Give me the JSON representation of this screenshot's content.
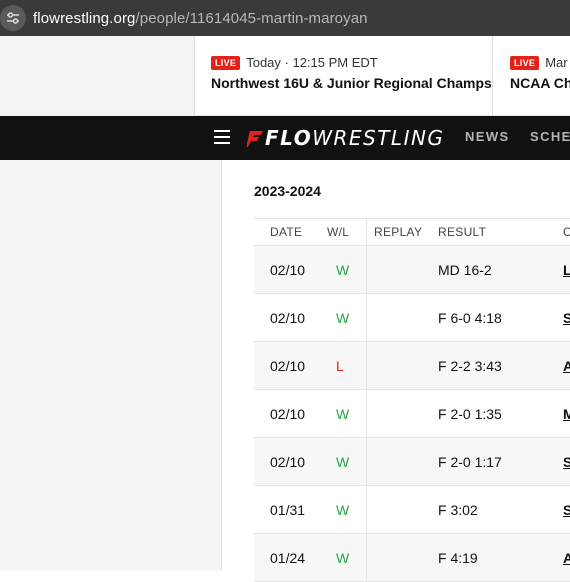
{
  "browser": {
    "url_host": "flowrestling.org",
    "url_path": "/people/11614045-martin-maroyan",
    "site_info_icon": "tune-icon"
  },
  "ticker": {
    "events": [
      {
        "badge": "LIVE",
        "when": "Today · 12:15 PM EDT",
        "title": "Northwest 16U & Junior Regional Champs"
      },
      {
        "badge": "LIVE",
        "when": "Mar :",
        "title": "NCAA Cha"
      }
    ]
  },
  "nav": {
    "menu_icon": "hamburger-menu-icon",
    "logo_bold": "FLO",
    "logo_light": "WRESTLING",
    "links": [
      "NEWS",
      "SCHEI"
    ]
  },
  "season": {
    "label": "2023-2024"
  },
  "table": {
    "headers": [
      "DATE",
      "W/L",
      "REPLAY",
      "RESULT",
      "O"
    ],
    "rows": [
      {
        "date": "02/10",
        "wl": "W",
        "replay": "",
        "result": "MD 16-2",
        "opp": "L"
      },
      {
        "date": "02/10",
        "wl": "W",
        "replay": "",
        "result": "F 6-0 4:18",
        "opp": "S"
      },
      {
        "date": "02/10",
        "wl": "L",
        "replay": "",
        "result": "F 2-2 3:43",
        "opp": "A"
      },
      {
        "date": "02/10",
        "wl": "W",
        "replay": "",
        "result": "F 2-0 1:35",
        "opp": "M"
      },
      {
        "date": "02/10",
        "wl": "W",
        "replay": "",
        "result": "F 2-0 1:17",
        "opp": "S"
      },
      {
        "date": "01/31",
        "wl": "W",
        "replay": "",
        "result": "F 3:02",
        "opp": "S"
      },
      {
        "date": "01/24",
        "wl": "W",
        "replay": "",
        "result": "F 4:19",
        "opp": "A"
      }
    ]
  },
  "colors": {
    "win": "#21a845",
    "loss": "#e2231a",
    "live": "#e2231a",
    "nav_bg": "#111111"
  }
}
